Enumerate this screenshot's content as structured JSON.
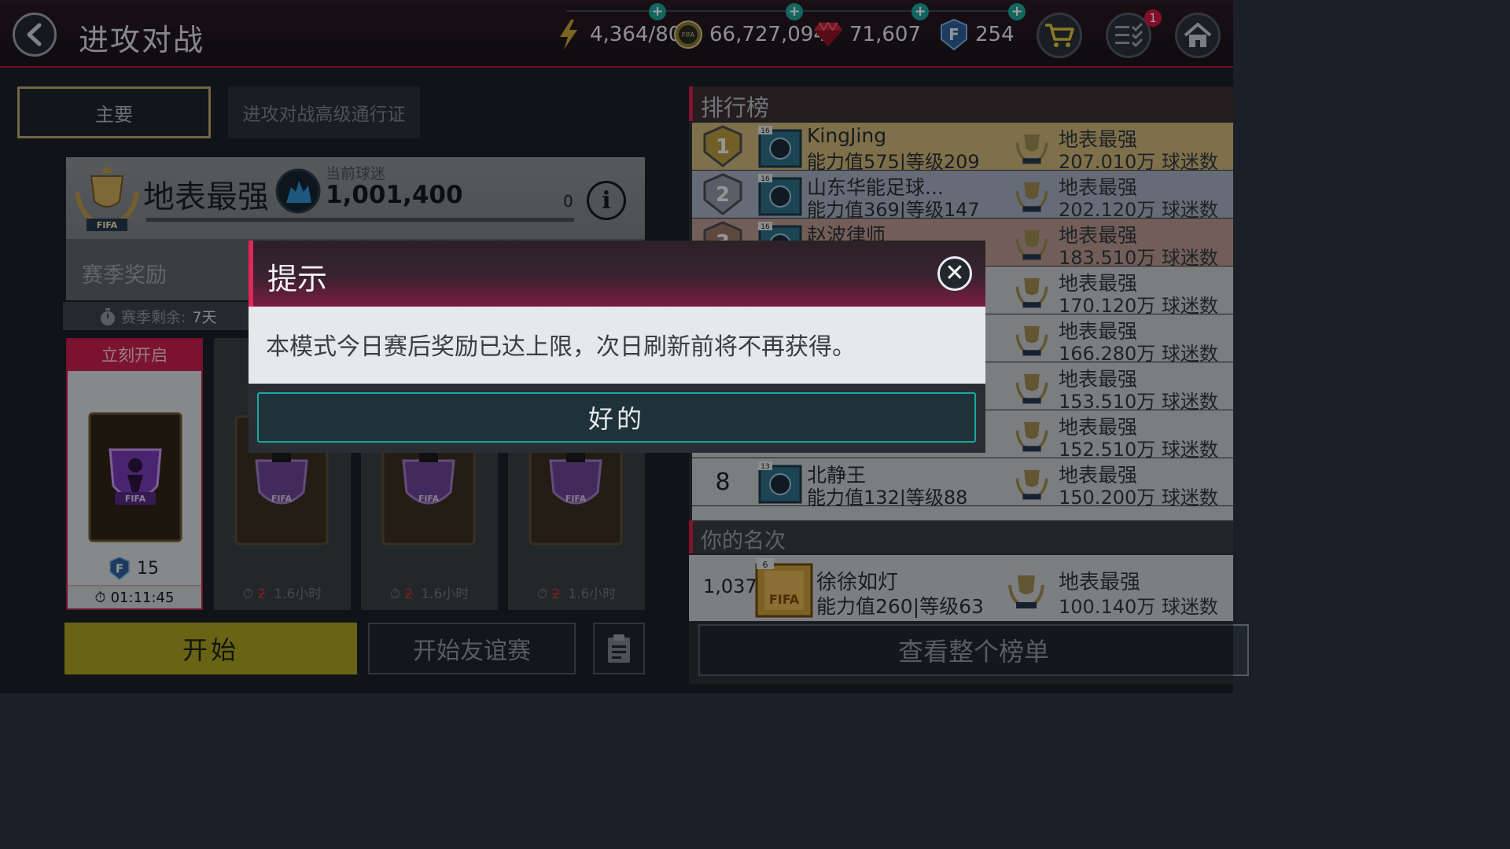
{
  "header": {
    "title": "进攻对战",
    "energy": "4,364/80",
    "coins": "66,727,094",
    "gems": "71,607",
    "fifa_points": "254",
    "notification_count": "1"
  },
  "tabs": {
    "main": "主要",
    "premium_pass": "进攻对战高级通行证"
  },
  "league": {
    "name": "地表最强",
    "fans_label": "当前球迷",
    "fans_value": "1,001,400",
    "progress_value": "0"
  },
  "season": {
    "title": "赛季奖励",
    "remaining_label": "赛季剩余:",
    "remaining_value": "7天"
  },
  "rewards": {
    "open_now": "立刻开启",
    "active_count": "15",
    "active_timer": "01:11:45",
    "locked_old": "2",
    "locked_time": "1.6小时"
  },
  "buttons": {
    "start": "开始",
    "friendly": "开始友谊赛",
    "view_full": "查看整个榜单"
  },
  "leaderboard": {
    "title": "排行榜",
    "your_rank_title": "你的名次",
    "rows": [
      {
        "rank": "1",
        "level_badge": "16",
        "name": "KingJing",
        "stat": "能力值575|等级209",
        "league": "地表最强",
        "fans": "207.010万 球迷数",
        "color": "#cbb57a"
      },
      {
        "rank": "2",
        "level_badge": "16",
        "name": "山东华能足球...",
        "stat": "能力值369|等级147",
        "league": "地表最强",
        "fans": "202.120万 球迷数",
        "color": "#a3afc2"
      },
      {
        "rank": "3",
        "level_badge": "16",
        "name": "赵波律师",
        "stat": "",
        "league": "地表最强",
        "fans": "183.510万 球迷数",
        "color": "#b9988f"
      },
      {
        "rank": "",
        "level_badge": "",
        "name": "",
        "stat": "",
        "league": "地表最强",
        "fans": "170.120万 球迷数",
        "color": "#c7cacd"
      },
      {
        "rank": "",
        "level_badge": "",
        "name": "",
        "stat": "",
        "league": "地表最强",
        "fans": "166.280万 球迷数",
        "color": "#c7cacd"
      },
      {
        "rank": "",
        "level_badge": "",
        "name": "",
        "stat": "",
        "league": "地表最强",
        "fans": "153.510万 球迷数",
        "color": "#c7cacd"
      },
      {
        "rank": "",
        "level_badge": "",
        "name": "",
        "stat": "",
        "league": "地表最强",
        "fans": "152.510万 球迷数",
        "color": "#c7cacd"
      },
      {
        "rank": "8",
        "level_badge": "13",
        "name": "北静王",
        "stat": "能力值132|等级88",
        "league": "地表最强",
        "fans": "150.200万 球迷数",
        "color": "#c7cacd"
      }
    ],
    "you": {
      "rank": "1,037",
      "level_badge": "6",
      "name": "徐徐如灯",
      "stat": "能力值260|等级63",
      "league": "地表最强",
      "fans": "100.140万 球迷数"
    }
  },
  "dialog": {
    "title": "提示",
    "message": "本模式今日赛后奖励已达上限，次日刷新前将不再获得。",
    "ok": "好的"
  },
  "colors": {
    "accent": "#d61f4e",
    "start_button": "#a9a221",
    "ok_border": "#1aa79e"
  }
}
